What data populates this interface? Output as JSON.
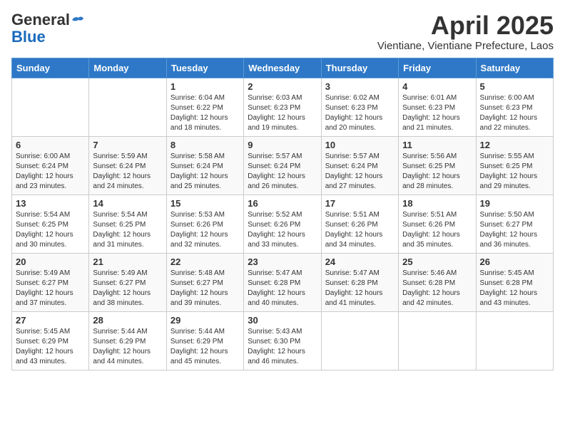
{
  "header": {
    "logo_general": "General",
    "logo_blue": "Blue",
    "title": "April 2025",
    "location": "Vientiane, Vientiane Prefecture, Laos"
  },
  "weekdays": [
    "Sunday",
    "Monday",
    "Tuesday",
    "Wednesday",
    "Thursday",
    "Friday",
    "Saturday"
  ],
  "weeks": [
    [
      {
        "day": "",
        "info": ""
      },
      {
        "day": "",
        "info": ""
      },
      {
        "day": "1",
        "info": "Sunrise: 6:04 AM\nSunset: 6:22 PM\nDaylight: 12 hours and 18 minutes."
      },
      {
        "day": "2",
        "info": "Sunrise: 6:03 AM\nSunset: 6:23 PM\nDaylight: 12 hours and 19 minutes."
      },
      {
        "day": "3",
        "info": "Sunrise: 6:02 AM\nSunset: 6:23 PM\nDaylight: 12 hours and 20 minutes."
      },
      {
        "day": "4",
        "info": "Sunrise: 6:01 AM\nSunset: 6:23 PM\nDaylight: 12 hours and 21 minutes."
      },
      {
        "day": "5",
        "info": "Sunrise: 6:00 AM\nSunset: 6:23 PM\nDaylight: 12 hours and 22 minutes."
      }
    ],
    [
      {
        "day": "6",
        "info": "Sunrise: 6:00 AM\nSunset: 6:24 PM\nDaylight: 12 hours and 23 minutes."
      },
      {
        "day": "7",
        "info": "Sunrise: 5:59 AM\nSunset: 6:24 PM\nDaylight: 12 hours and 24 minutes."
      },
      {
        "day": "8",
        "info": "Sunrise: 5:58 AM\nSunset: 6:24 PM\nDaylight: 12 hours and 25 minutes."
      },
      {
        "day": "9",
        "info": "Sunrise: 5:57 AM\nSunset: 6:24 PM\nDaylight: 12 hours and 26 minutes."
      },
      {
        "day": "10",
        "info": "Sunrise: 5:57 AM\nSunset: 6:24 PM\nDaylight: 12 hours and 27 minutes."
      },
      {
        "day": "11",
        "info": "Sunrise: 5:56 AM\nSunset: 6:25 PM\nDaylight: 12 hours and 28 minutes."
      },
      {
        "day": "12",
        "info": "Sunrise: 5:55 AM\nSunset: 6:25 PM\nDaylight: 12 hours and 29 minutes."
      }
    ],
    [
      {
        "day": "13",
        "info": "Sunrise: 5:54 AM\nSunset: 6:25 PM\nDaylight: 12 hours and 30 minutes."
      },
      {
        "day": "14",
        "info": "Sunrise: 5:54 AM\nSunset: 6:25 PM\nDaylight: 12 hours and 31 minutes."
      },
      {
        "day": "15",
        "info": "Sunrise: 5:53 AM\nSunset: 6:26 PM\nDaylight: 12 hours and 32 minutes."
      },
      {
        "day": "16",
        "info": "Sunrise: 5:52 AM\nSunset: 6:26 PM\nDaylight: 12 hours and 33 minutes."
      },
      {
        "day": "17",
        "info": "Sunrise: 5:51 AM\nSunset: 6:26 PM\nDaylight: 12 hours and 34 minutes."
      },
      {
        "day": "18",
        "info": "Sunrise: 5:51 AM\nSunset: 6:26 PM\nDaylight: 12 hours and 35 minutes."
      },
      {
        "day": "19",
        "info": "Sunrise: 5:50 AM\nSunset: 6:27 PM\nDaylight: 12 hours and 36 minutes."
      }
    ],
    [
      {
        "day": "20",
        "info": "Sunrise: 5:49 AM\nSunset: 6:27 PM\nDaylight: 12 hours and 37 minutes."
      },
      {
        "day": "21",
        "info": "Sunrise: 5:49 AM\nSunset: 6:27 PM\nDaylight: 12 hours and 38 minutes."
      },
      {
        "day": "22",
        "info": "Sunrise: 5:48 AM\nSunset: 6:27 PM\nDaylight: 12 hours and 39 minutes."
      },
      {
        "day": "23",
        "info": "Sunrise: 5:47 AM\nSunset: 6:28 PM\nDaylight: 12 hours and 40 minutes."
      },
      {
        "day": "24",
        "info": "Sunrise: 5:47 AM\nSunset: 6:28 PM\nDaylight: 12 hours and 41 minutes."
      },
      {
        "day": "25",
        "info": "Sunrise: 5:46 AM\nSunset: 6:28 PM\nDaylight: 12 hours and 42 minutes."
      },
      {
        "day": "26",
        "info": "Sunrise: 5:45 AM\nSunset: 6:28 PM\nDaylight: 12 hours and 43 minutes."
      }
    ],
    [
      {
        "day": "27",
        "info": "Sunrise: 5:45 AM\nSunset: 6:29 PM\nDaylight: 12 hours and 43 minutes."
      },
      {
        "day": "28",
        "info": "Sunrise: 5:44 AM\nSunset: 6:29 PM\nDaylight: 12 hours and 44 minutes."
      },
      {
        "day": "29",
        "info": "Sunrise: 5:44 AM\nSunset: 6:29 PM\nDaylight: 12 hours and 45 minutes."
      },
      {
        "day": "30",
        "info": "Sunrise: 5:43 AM\nSunset: 6:30 PM\nDaylight: 12 hours and 46 minutes."
      },
      {
        "day": "",
        "info": ""
      },
      {
        "day": "",
        "info": ""
      },
      {
        "day": "",
        "info": ""
      }
    ]
  ]
}
